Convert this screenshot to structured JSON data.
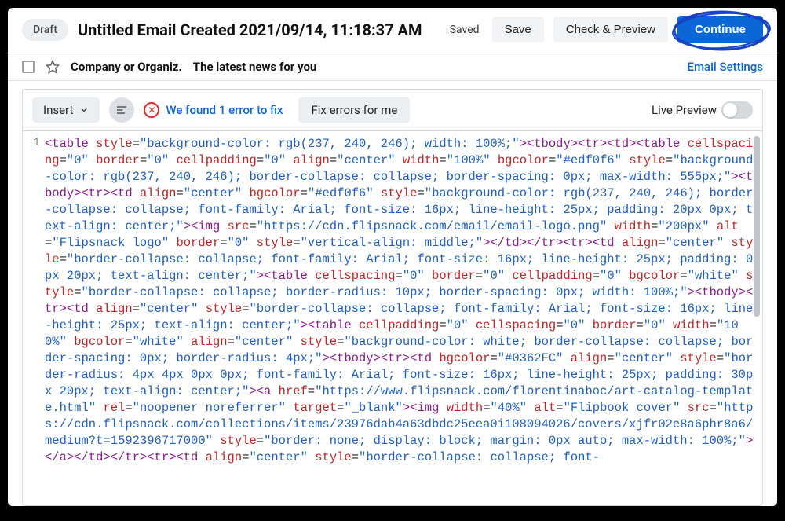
{
  "header": {
    "draft_badge": "Draft",
    "title": "Untitled Email Created 2021/09/14, 11:18:37 AM",
    "saved_label": "Saved",
    "save_btn": "Save",
    "check_preview_btn": "Check & Preview",
    "continue_btn": "Continue"
  },
  "subject_row": {
    "company": "Company or Organiz.",
    "subject": "The latest news for you",
    "email_settings": "Email Settings"
  },
  "toolbar": {
    "insert_label": "Insert",
    "error_text": "We found 1 error to fix",
    "fix_btn": "Fix errors for me",
    "live_preview_label": "Live Preview"
  },
  "gutter_line": "1"
}
